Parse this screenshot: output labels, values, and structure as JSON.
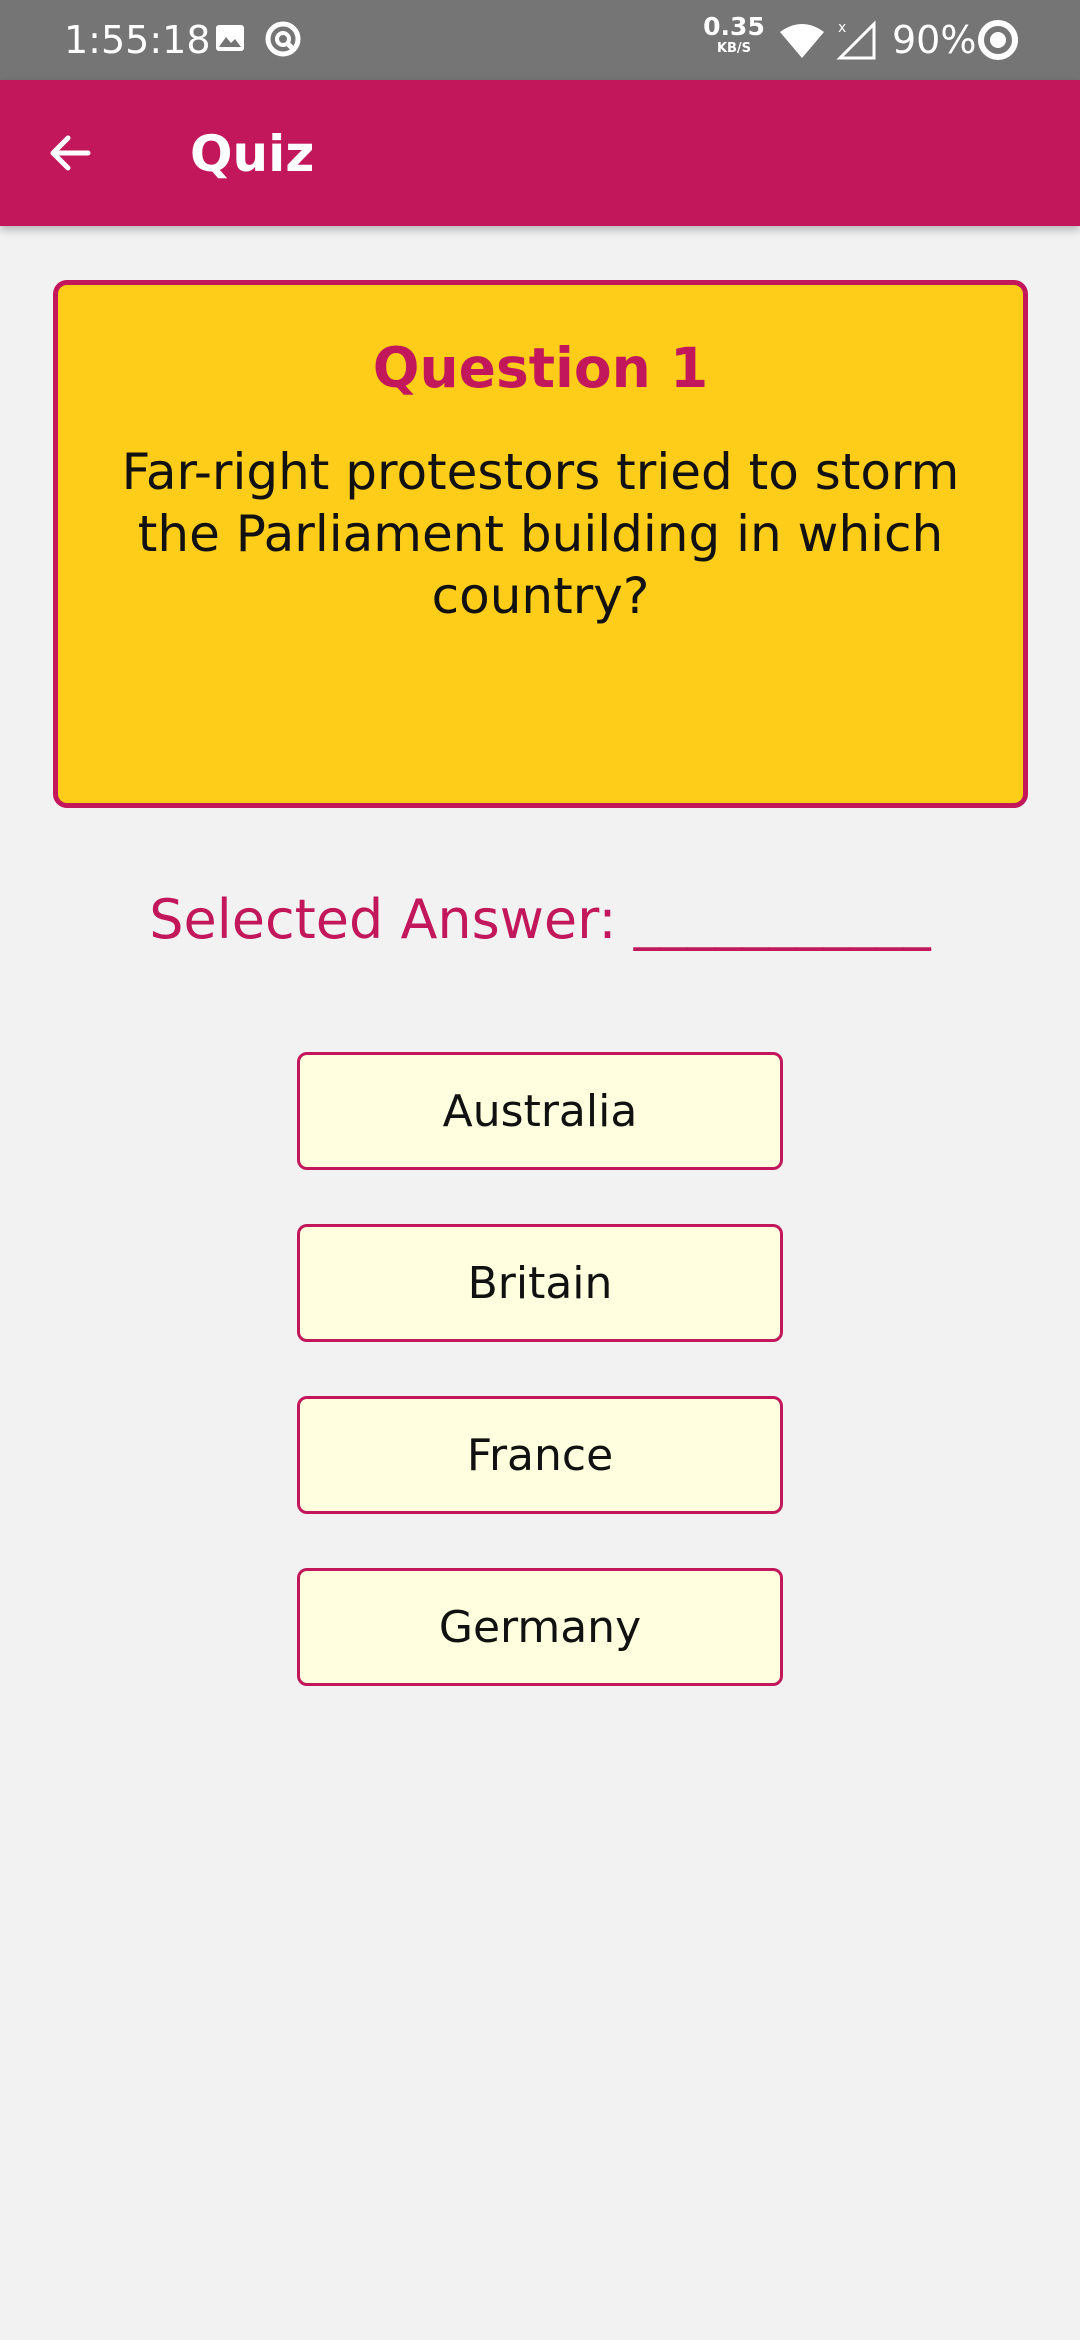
{
  "status_bar": {
    "time": "1:55:18",
    "net_speed_value": "0.35",
    "net_speed_unit": "KB/S",
    "battery": "90%",
    "icons": [
      "image-icon",
      "sync-icon",
      "wifi-icon",
      "signal-icon",
      "battery-icon"
    ]
  },
  "app_bar": {
    "title": "Quiz",
    "back_icon": "arrow-left-icon",
    "color": "#c2185b"
  },
  "question": {
    "title": "Question 1",
    "text": "Far-right protestors tried to storm the Parliament building in which country?",
    "card_color": "#fecd1a"
  },
  "selected_answer": {
    "label": "Selected Answer: ___________"
  },
  "options": [
    {
      "label": "Australia"
    },
    {
      "label": "Britain"
    },
    {
      "label": "France"
    },
    {
      "label": "Germany"
    }
  ],
  "colors": {
    "accent": "#c2185b",
    "option_bg": "#ffffe0",
    "background": "#f2f2f2"
  }
}
